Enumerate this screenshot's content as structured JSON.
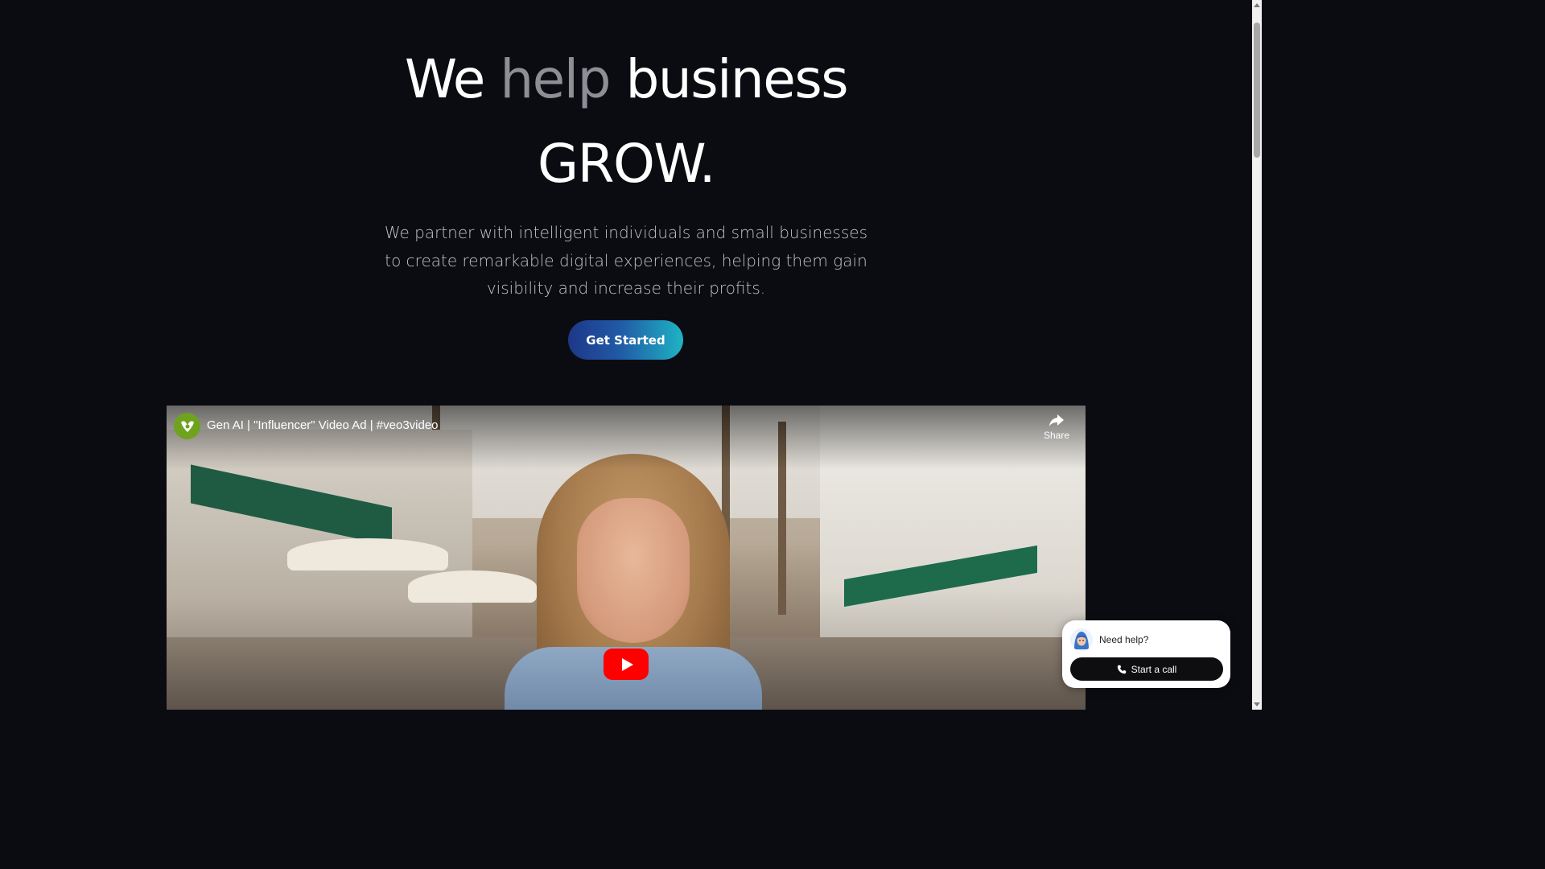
{
  "hero": {
    "title_we": "We",
    "title_help": "help",
    "title_business": "business",
    "title_grow": "GROW.",
    "subtitle": "We partner with intelligent individuals and small businesses to create remarkable digital experiences, helping them gain visibility and increase their profits.",
    "cta_label": "Get Started"
  },
  "video": {
    "title": "Gen AI | \"Influencer\" Video Ad | #veo3video",
    "channel_icon": "channel-logo-icon",
    "share_label": "Share",
    "share_icon": "share-icon",
    "play_icon": "youtube-play-icon"
  },
  "chat": {
    "prompt": "Need help?",
    "call_label": "Start a call",
    "avatar_icon": "support-avatar-icon",
    "call_icon": "phone-icon"
  },
  "colors": {
    "background": "#0b0c12",
    "muted_word": "#8e8e95",
    "cta_gradient_start": "#1e3788",
    "cta_gradient_end": "#1fb3c4",
    "youtube_red": "#ff0000"
  }
}
